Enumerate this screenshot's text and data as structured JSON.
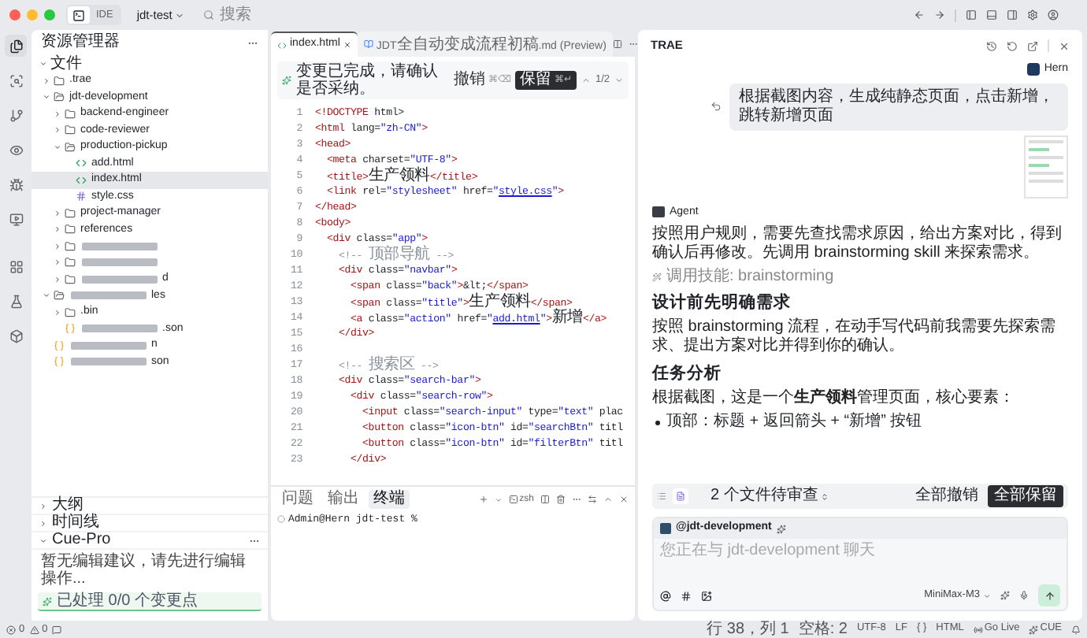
{
  "window": {
    "mode_label": "IDE",
    "project": "jdt-test",
    "search_placeholder": "搜索"
  },
  "activity_bar": [
    {
      "kind": "files",
      "selected": true
    },
    {
      "kind": "search",
      "selected": false
    },
    {
      "kind": "git",
      "selected": false
    },
    {
      "kind": "preview",
      "selected": false
    },
    {
      "kind": "debug",
      "selected": false
    },
    {
      "kind": "remote",
      "selected": false
    },
    {
      "kind": "extensions",
      "selected": false
    },
    {
      "kind": "testing",
      "selected": false
    },
    {
      "kind": "packages",
      "selected": false
    }
  ],
  "explorer": {
    "title": "资源管理器",
    "section": {
      "label": "文件",
      "expanded": true
    },
    "tree": [
      {
        "kind": "folder",
        "label": ".trae",
        "expanded": false,
        "selected": false
      },
      {
        "kind": "folder",
        "label": "jdt-development",
        "expanded": true,
        "selected": false,
        "children": [
          {
            "kind": "folder",
            "label": "backend-engineer",
            "expanded": false,
            "selected": false
          },
          {
            "kind": "folder",
            "label": "code-reviewer",
            "expanded": false,
            "selected": false
          },
          {
            "kind": "folder",
            "label": "production-pickup",
            "expanded": true,
            "selected": false,
            "children": [
              {
                "kind": "html",
                "label": "add.html",
                "selected": false
              },
              {
                "kind": "html",
                "label": "index.html",
                "selected": true
              },
              {
                "kind": "css",
                "label": "style.css",
                "selected": false
              }
            ]
          },
          {
            "kind": "folder",
            "label": "project-manager",
            "expanded": false,
            "selected": false
          },
          {
            "kind": "folder",
            "label": "references",
            "expanded": false,
            "selected": false
          },
          {
            "kind": "folder",
            "redacted": true,
            "expanded": false,
            "selected": false
          },
          {
            "kind": "folder",
            "redacted": true,
            "expanded": false,
            "selected": false
          },
          {
            "kind": "folder",
            "redacted": true,
            "label": "d",
            "expanded": false,
            "selected": false
          }
        ]
      },
      {
        "kind": "folder",
        "redacted": true,
        "label": "les",
        "expanded": true,
        "selected": false,
        "children": [
          {
            "kind": "folder",
            "label": ".bin",
            "expanded": false,
            "selected": false
          },
          {
            "kind": "json",
            "redacted": true,
            "label": ".son",
            "selected": false
          }
        ]
      },
      {
        "kind": "json",
        "redacted": true,
        "label": "n",
        "selected": false
      },
      {
        "kind": "json",
        "redacted": true,
        "label": "son",
        "selected": false
      }
    ]
  },
  "panels": [
    {
      "label": "大纲",
      "expanded": false
    },
    {
      "label": "时间线",
      "expanded": false
    },
    {
      "label": "Cue-Pro",
      "expanded": true
    }
  ],
  "cue_pro": {
    "message": "暂无编辑建议，请先进行编辑操作...",
    "progress": "已处理 0/0 个变更点"
  },
  "editor": {
    "tabs": [
      {
        "kind": "html",
        "label": "index.html",
        "selected": true
      },
      {
        "kind": "preview",
        "label": "JDT全自动变成流程初稿.md (Preview)",
        "selected": false
      }
    ],
    "change_bar": {
      "message": "变更已完成，请确认是否采纳。",
      "undo_label": "撤销",
      "undo_shortcut": "⌘⌫",
      "keep_label": "保留",
      "keep_shortcut": "⌘↵",
      "counter": "1/2"
    },
    "lines": [
      {
        "n": "1",
        "tokens": [
          {
            "kind": "tag",
            "text": "<!DOCTYPE"
          },
          {
            "kind": "plain",
            "text": " html>"
          }
        ]
      },
      {
        "n": "2",
        "tokens": [
          {
            "kind": "tag",
            "text": "<html"
          },
          {
            "kind": "plain",
            "text": " lang="
          },
          {
            "kind": "str",
            "text": "\"zh-CN\""
          },
          {
            "kind": "tag",
            "text": ">"
          }
        ]
      },
      {
        "n": "3",
        "tokens": [
          {
            "kind": "tag",
            "text": "<head>"
          }
        ]
      },
      {
        "n": "4",
        "tokens": [
          {
            "kind": "tag",
            "text": "  <meta"
          },
          {
            "kind": "plain",
            "text": " charset="
          },
          {
            "kind": "str",
            "text": "\"UTF-8\""
          },
          {
            "kind": "tag",
            "text": ">"
          }
        ]
      },
      {
        "n": "5",
        "tokens": [
          {
            "kind": "tag",
            "text": "  <title>"
          },
          {
            "kind": "plain",
            "text": "生产领料"
          },
          {
            "kind": "tag",
            "text": "</title>"
          }
        ]
      },
      {
        "n": "6",
        "tokens": [
          {
            "kind": "tag",
            "text": "  <link"
          },
          {
            "kind": "plain",
            "text": " rel="
          },
          {
            "kind": "str",
            "text": "\"stylesheet\""
          },
          {
            "kind": "plain",
            "text": " href="
          },
          {
            "kind": "str",
            "text": "\""
          },
          {
            "kind": "link",
            "text": "style.css"
          },
          {
            "kind": "str",
            "text": "\""
          },
          {
            "kind": "tag",
            "text": ">"
          }
        ]
      },
      {
        "n": "7",
        "tokens": [
          {
            "kind": "tag",
            "text": "</head>"
          }
        ]
      },
      {
        "n": "8",
        "tokens": [
          {
            "kind": "tag",
            "text": "<body>"
          }
        ]
      },
      {
        "n": "9",
        "tokens": [
          {
            "kind": "tag",
            "text": "  <div"
          },
          {
            "kind": "plain",
            "text": " class="
          },
          {
            "kind": "str",
            "text": "\"app\""
          },
          {
            "kind": "tag",
            "text": ">"
          }
        ]
      },
      {
        "n": "10",
        "tokens": [
          {
            "kind": "comment",
            "text": "    <!-- 顶部导航 -->"
          }
        ]
      },
      {
        "n": "11",
        "tokens": [
          {
            "kind": "tag",
            "text": "    <div"
          },
          {
            "kind": "plain",
            "text": " class="
          },
          {
            "kind": "str",
            "text": "\"navbar\""
          },
          {
            "kind": "tag",
            "text": ">"
          }
        ]
      },
      {
        "n": "12",
        "tokens": [
          {
            "kind": "tag",
            "text": "      <span"
          },
          {
            "kind": "plain",
            "text": " class="
          },
          {
            "kind": "str",
            "text": "\"back\""
          },
          {
            "kind": "tag",
            "text": ">"
          },
          {
            "kind": "plain",
            "text": "&lt;"
          },
          {
            "kind": "tag",
            "text": "</span>"
          }
        ]
      },
      {
        "n": "13",
        "tokens": [
          {
            "kind": "tag",
            "text": "      <span"
          },
          {
            "kind": "plain",
            "text": " class="
          },
          {
            "kind": "str",
            "text": "\"title\""
          },
          {
            "kind": "tag",
            "text": ">"
          },
          {
            "kind": "plain",
            "text": "生产领料"
          },
          {
            "kind": "tag",
            "text": "</span>"
          }
        ]
      },
      {
        "n": "14",
        "tokens": [
          {
            "kind": "tag",
            "text": "      <a"
          },
          {
            "kind": "plain",
            "text": " class="
          },
          {
            "kind": "str",
            "text": "\"action\""
          },
          {
            "kind": "plain",
            "text": " href="
          },
          {
            "kind": "str",
            "text": "\""
          },
          {
            "kind": "link",
            "text": "add.html"
          },
          {
            "kind": "str",
            "text": "\""
          },
          {
            "kind": "tag",
            "text": ">"
          },
          {
            "kind": "plain",
            "text": "新增"
          },
          {
            "kind": "tag",
            "text": "</a>"
          }
        ]
      },
      {
        "n": "15",
        "tokens": [
          {
            "kind": "tag",
            "text": "    </div>"
          }
        ]
      },
      {
        "n": "16"
      },
      {
        "n": "17",
        "tokens": [
          {
            "kind": "comment",
            "text": "    <!-- 搜索区 -->"
          }
        ]
      },
      {
        "n": "18",
        "tokens": [
          {
            "kind": "tag",
            "text": "    <div"
          },
          {
            "kind": "plain",
            "text": " class="
          },
          {
            "kind": "str",
            "text": "\"search-bar\""
          },
          {
            "kind": "tag",
            "text": ">"
          }
        ]
      },
      {
        "n": "19",
        "tokens": [
          {
            "kind": "tag",
            "text": "      <div"
          },
          {
            "kind": "plain",
            "text": " class="
          },
          {
            "kind": "str",
            "text": "\"search-row\""
          },
          {
            "kind": "tag",
            "text": ">"
          }
        ]
      },
      {
        "n": "20",
        "tokens": [
          {
            "kind": "tag",
            "text": "        <input"
          },
          {
            "kind": "plain",
            "text": " class="
          },
          {
            "kind": "str",
            "text": "\"search-input\""
          },
          {
            "kind": "plain",
            "text": " type="
          },
          {
            "kind": "str",
            "text": "\"text\""
          },
          {
            "kind": "plain",
            "text": " plac"
          }
        ]
      },
      {
        "n": "21",
        "tokens": [
          {
            "kind": "tag",
            "text": "        <button"
          },
          {
            "kind": "plain",
            "text": " class="
          },
          {
            "kind": "str",
            "text": "\"icon-btn\""
          },
          {
            "kind": "plain",
            "text": " id="
          },
          {
            "kind": "str",
            "text": "\"searchBtn\""
          },
          {
            "kind": "plain",
            "text": " titl"
          }
        ]
      },
      {
        "n": "22",
        "tokens": [
          {
            "kind": "tag",
            "text": "        <button"
          },
          {
            "kind": "plain",
            "text": " class="
          },
          {
            "kind": "str",
            "text": "\"icon-btn\""
          },
          {
            "kind": "plain",
            "text": " id="
          },
          {
            "kind": "str",
            "text": "\"filterBtn\""
          },
          {
            "kind": "plain",
            "text": " titl"
          }
        ]
      },
      {
        "n": "23",
        "tokens": [
          {
            "kind": "tag",
            "text": "      </div>"
          }
        ]
      }
    ]
  },
  "terminal": {
    "tabs": [
      {
        "label": "问题",
        "selected": false
      },
      {
        "label": "输出",
        "selected": false
      },
      {
        "label": "终端",
        "selected": true
      }
    ],
    "shell": "zsh",
    "prompt": "Admin@Hern jdt-test %"
  },
  "chat": {
    "title": "TRAE",
    "user": "Hern",
    "user_message": "根据截图内容，生成纯静态页面，点击新增，跳转新增页面",
    "agent": "Agent",
    "blocks": [
      {
        "kind": "paragraph",
        "text": "按照用户规则，需要先查找需求原因，给出方案对比，得到确认后再修改。先调用 brainstorming skill 来探索需求。"
      },
      {
        "kind": "skill",
        "text": "调用技能: brainstorming"
      },
      {
        "kind": "heading",
        "text": "设计前先明确需求"
      },
      {
        "kind": "paragraph",
        "text": "按照 brainstorming 流程，在动手写代码前我需要先探索需求、提出方案对比并得到你的确认。"
      },
      {
        "kind": "heading",
        "text": "任务分析"
      },
      {
        "kind": "paragraph",
        "text": "根据截图，这是一个**生产领料**管理页面，核心要素："
      },
      {
        "kind": "bullet",
        "text": "顶部：标题 + 返回箭头 + “新增” 按钮"
      }
    ],
    "review": {
      "label": "2 个文件待审查",
      "discard_all": "全部撤销",
      "keep_all": "全部保留"
    },
    "composer": {
      "context": "@jdt-development",
      "placeholder": "您正在与 jdt-development 聊天",
      "model": "MiniMax-M3"
    }
  },
  "status_bar": {
    "errors": "0",
    "warnings": "0",
    "items": [
      {
        "kind": "text",
        "text": "行 38，列 1"
      },
      {
        "kind": "text",
        "text": "空格: 2"
      },
      {
        "kind": "text",
        "text": "UTF-8"
      },
      {
        "kind": "text",
        "text": "LF"
      },
      {
        "kind": "text",
        "text": "{ }"
      },
      {
        "kind": "text",
        "text": "HTML"
      },
      {
        "kind": "live_server",
        "text": "Go Live"
      },
      {
        "kind": "assistant",
        "text": "CUE"
      }
    ]
  }
}
